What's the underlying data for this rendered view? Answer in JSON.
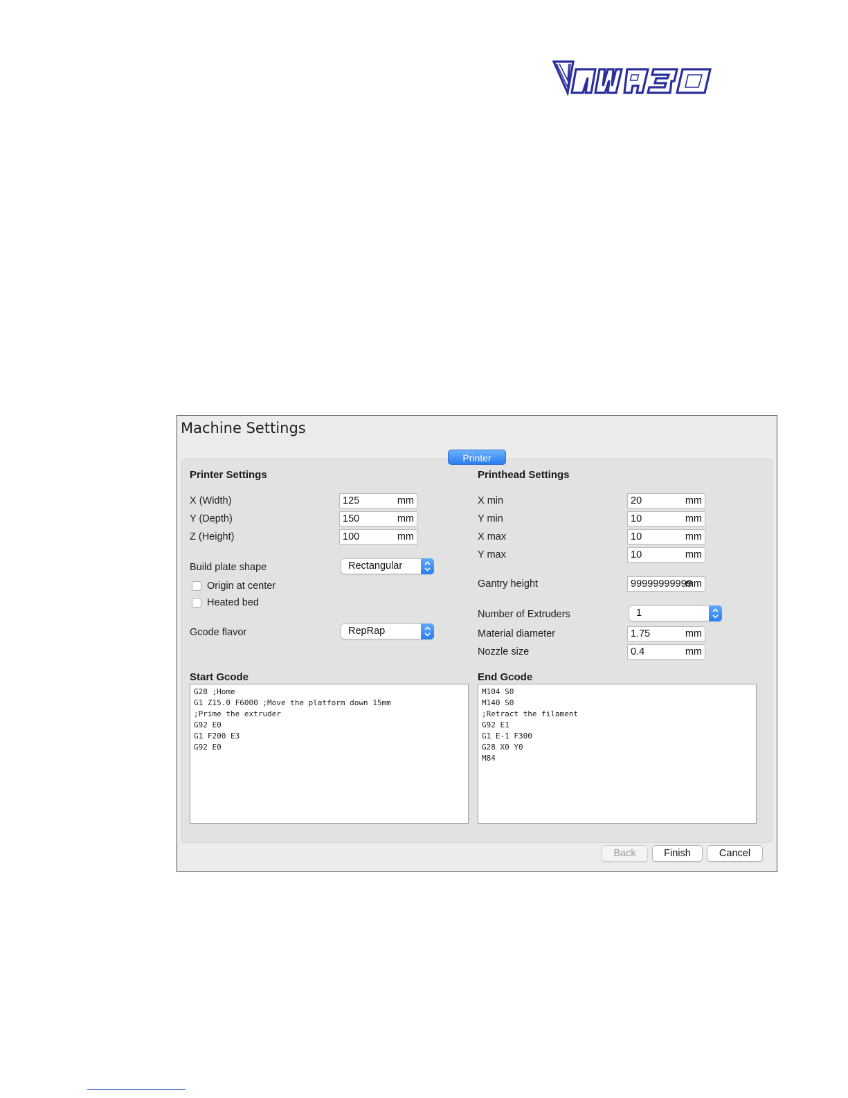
{
  "logo": {
    "text": "NWA3D",
    "color": "#2b2f9e"
  },
  "dialog": {
    "title": "Machine Settings",
    "tab": "Printer",
    "accent_color": "#2b7cf0",
    "printer_settings": {
      "heading": "Printer Settings",
      "x_width": {
        "label": "X (Width)",
        "value": "125",
        "unit": "mm"
      },
      "y_depth": {
        "label": "Y (Depth)",
        "value": "150",
        "unit": "mm"
      },
      "z_height": {
        "label": "Z (Height)",
        "value": "100",
        "unit": "mm"
      },
      "build_plate_shape": {
        "label": "Build plate shape",
        "value": "Rectangular"
      },
      "origin_at_center": {
        "label": "Origin at center",
        "checked": false
      },
      "heated_bed": {
        "label": "Heated bed",
        "checked": false
      },
      "gcode_flavor": {
        "label": "Gcode flavor",
        "value": "RepRap"
      }
    },
    "printhead_settings": {
      "heading": "Printhead Settings",
      "x_min": {
        "label": "X min",
        "value": "20",
        "unit": "mm"
      },
      "y_min": {
        "label": "Y min",
        "value": "10",
        "unit": "mm"
      },
      "x_max": {
        "label": "X max",
        "value": "10",
        "unit": "mm"
      },
      "y_max": {
        "label": "Y max",
        "value": "10",
        "unit": "mm"
      },
      "gantry_height": {
        "label": "Gantry height",
        "value": "99999999999",
        "unit": "mm"
      },
      "number_of_extruders": {
        "label": "Number of Extruders",
        "value": "1"
      },
      "material_diameter": {
        "label": "Material diameter",
        "value": "1.75",
        "unit": "mm"
      },
      "nozzle_size": {
        "label": "Nozzle size",
        "value": "0.4",
        "unit": "mm"
      }
    },
    "start_gcode": {
      "heading": "Start Gcode",
      "text": "G28 ;Home\nG1 Z15.0 F6000 ;Move the platform down 15mm\n;Prime the extruder\nG92 E0\nG1 F200 E3\nG92 E0"
    },
    "end_gcode": {
      "heading": "End Gcode",
      "text": "M104 S0\nM140 S0\n;Retract the filament\nG92 E1\nG1 E-1 F300\nG28 X0 Y0\nM84"
    },
    "buttons": {
      "back": "Back",
      "finish": "Finish",
      "cancel": "Cancel"
    }
  }
}
